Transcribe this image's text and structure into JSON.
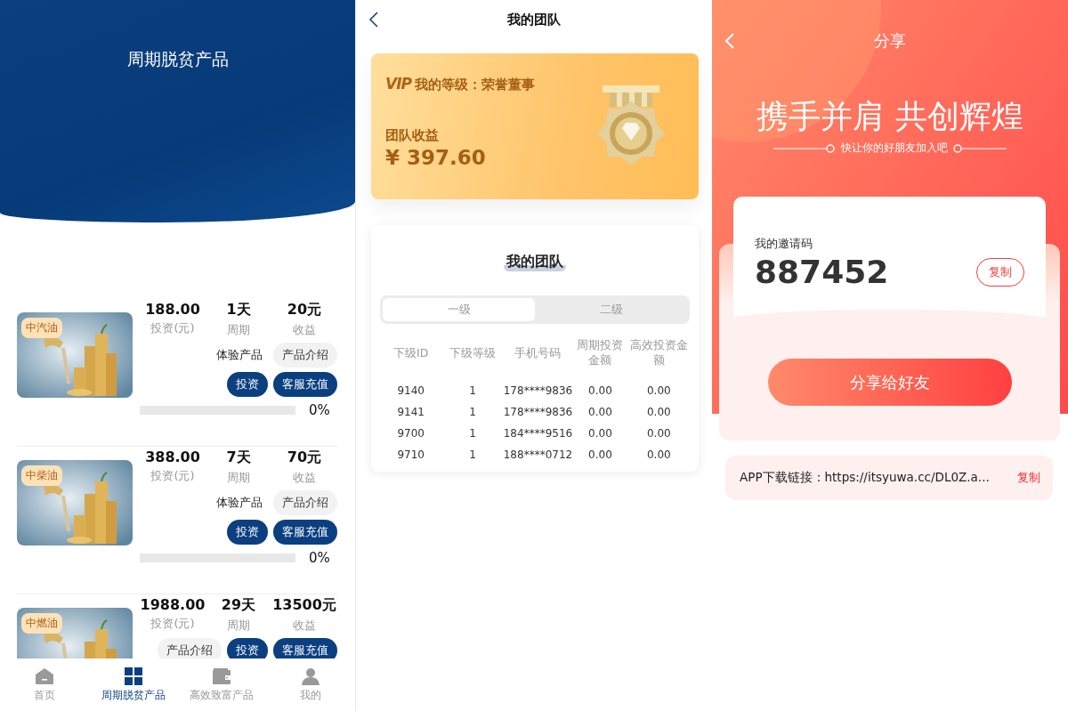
{
  "products_screen": {
    "title": "周期脱贫产品",
    "products": [
      {
        "badge": "中汽油",
        "stats": [
          {
            "value": "188.00",
            "label": "投资(元)"
          },
          {
            "value": "1天",
            "label": "周期"
          },
          {
            "value": "20元",
            "label": "收益"
          }
        ],
        "tag": "体验产品",
        "intro": "产品介绍",
        "invest": "投资",
        "recharge": "客服充值",
        "progress": {
          "level": 0,
          "reading": "0%"
        }
      },
      {
        "badge": "中柴油",
        "stats": [
          {
            "value": "388.00",
            "label": "投资(元)"
          },
          {
            "value": "7天",
            "label": "周期"
          },
          {
            "value": "70元",
            "label": "收益"
          }
        ],
        "tag": "体验产品",
        "intro": "产品介绍",
        "invest": "投资",
        "recharge": "客服充值",
        "progress": {
          "level": 0,
          "reading": "0%"
        }
      },
      {
        "badge": "中燃油",
        "stats": [
          {
            "value": "1988.00",
            "label": "投资(元)"
          },
          {
            "value": "29天",
            "label": "周期"
          },
          {
            "value": "13500元",
            "label": "收益"
          }
        ],
        "intro": "产品介绍",
        "invest": "投资",
        "recharge": "客服充值"
      }
    ],
    "tab_bar": [
      {
        "kind": "home",
        "label": "首页",
        "selected": false
      },
      {
        "kind": "grid",
        "label": "周期脱贫产品",
        "selected": true
      },
      {
        "kind": "wallet",
        "label": "高效致富产品",
        "selected": false
      },
      {
        "kind": "person",
        "label": "我的",
        "selected": false
      }
    ]
  },
  "team_screen": {
    "title": "我的团队",
    "level_card": {
      "vip": "VIP",
      "level": "我的等级：荣誉董事",
      "earnings_label": "团队收益",
      "earnings": "¥ 397.60"
    },
    "team_card": {
      "title": "我的团队",
      "tabs": [
        {
          "label": "一级",
          "selected": true
        },
        {
          "label": "二级",
          "selected": false
        }
      ],
      "table": {
        "columns": [
          "下级ID",
          "下级等级",
          "手机号码",
          "周期投资金额",
          "高效投资金额"
        ],
        "rows": [
          [
            "9140",
            "1",
            "178****9836",
            "0.00",
            "0.00"
          ],
          [
            "9141",
            "1",
            "178****9836",
            "0.00",
            "0.00"
          ],
          [
            "9700",
            "1",
            "184****9516",
            "0.00",
            "0.00"
          ],
          [
            "9710",
            "1",
            "188****0712",
            "0.00",
            "0.00"
          ]
        ]
      }
    }
  },
  "share_screen": {
    "title": "分享",
    "headline": "携手并肩 共创辉煌",
    "subtitle": "快让你的好朋友加入吧",
    "invite": {
      "label": "我的邀请码",
      "code": "887452",
      "copy": "复制"
    },
    "share_button": "分享给好友",
    "download": {
      "text": "APP下载链接：https://itsyuwa.cc/DL0Z.a...",
      "copy": "复制"
    }
  }
}
